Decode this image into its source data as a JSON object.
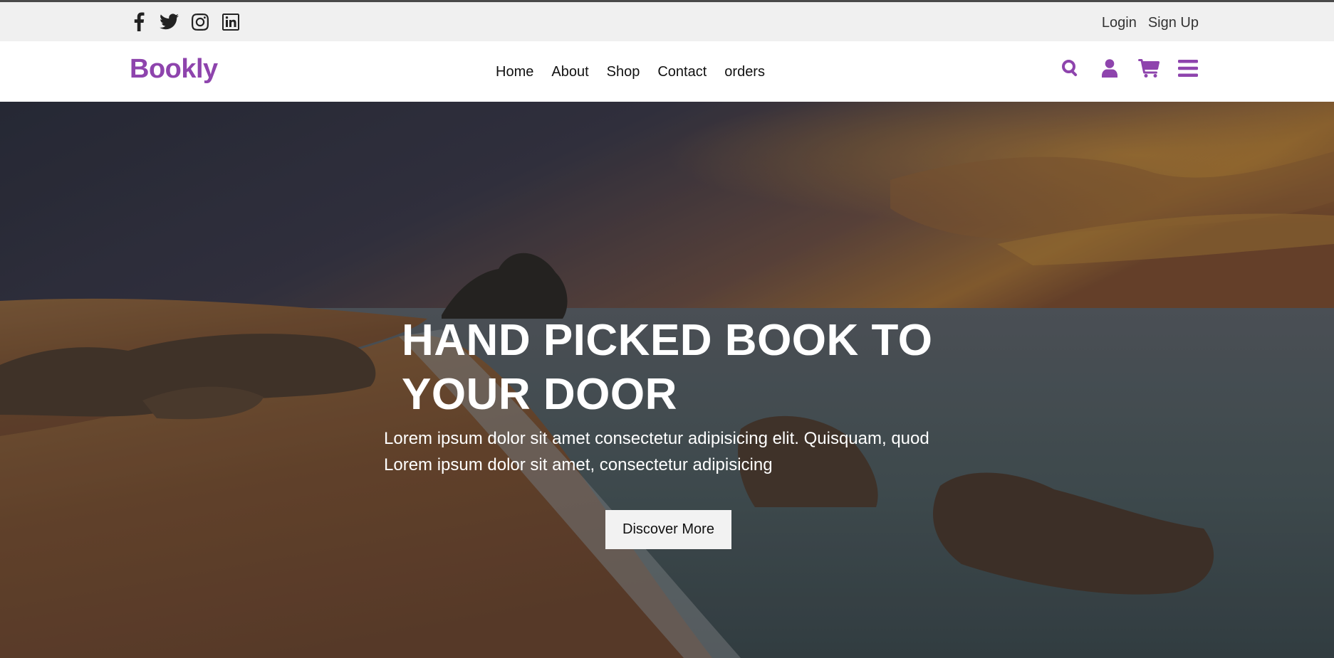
{
  "social": {
    "icons": [
      "facebook-icon",
      "twitter-icon",
      "instagram-icon",
      "linkedin-icon"
    ]
  },
  "auth": {
    "login_label": "Login",
    "signup_label": "Sign Up"
  },
  "header": {
    "logo": "Bookly",
    "nav": [
      {
        "label": "Home"
      },
      {
        "label": "About"
      },
      {
        "label": "Shop"
      },
      {
        "label": "Contact"
      },
      {
        "label": "orders"
      }
    ],
    "tools": [
      "search-icon",
      "user-icon",
      "cart-icon",
      "menu-icon"
    ]
  },
  "hero": {
    "title_line1": "HAND PICKED BOOK TO",
    "title_line2": "YOUR DOOR",
    "text_line1": "Lorem ipsum dolor sit amet consectetur adipisicing elit. Quisquam, quod",
    "text_line2": "Lorem ipsum dolor sit amet, consectetur adipisicing",
    "button_label": "Discover More"
  },
  "colors": {
    "accent": "#8e44ad",
    "topbar_bg": "#f0f0f0",
    "button_bg": "#f2f2f2"
  }
}
